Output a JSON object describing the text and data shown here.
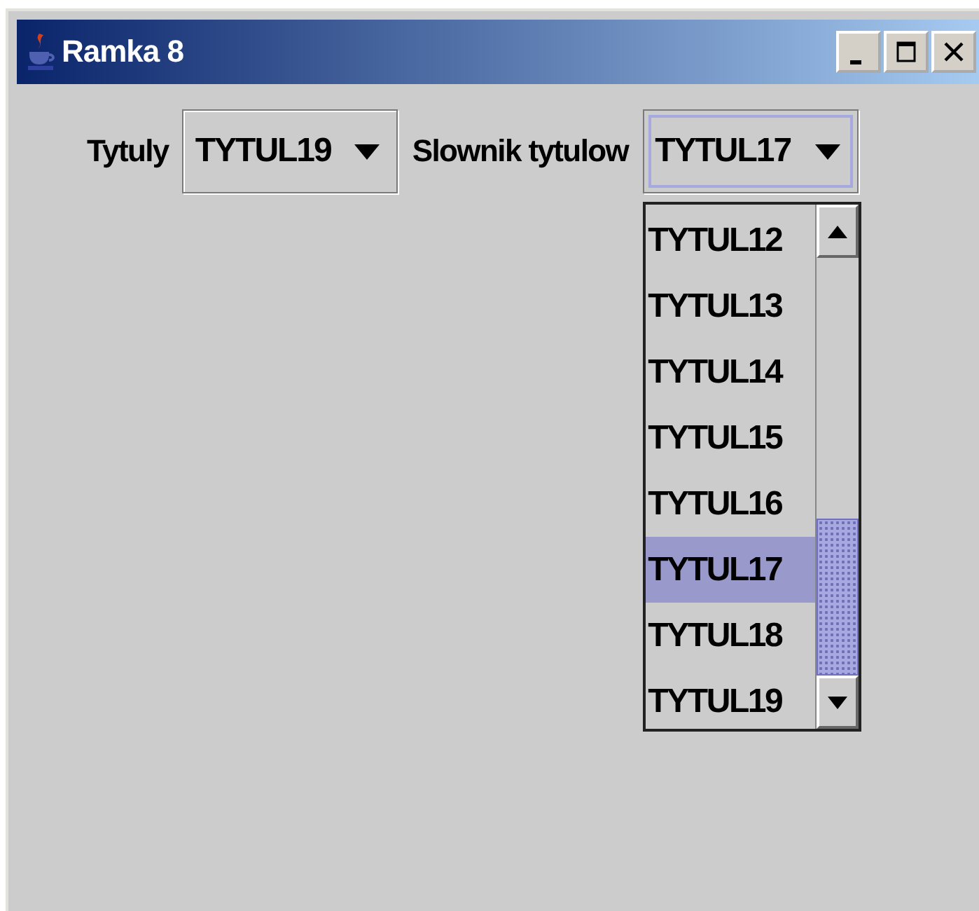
{
  "window": {
    "title": "Ramka 8"
  },
  "row": [
    {
      "kind": "label",
      "text": "Tytuly"
    },
    {
      "kind": "combo",
      "value": "TYTUL19",
      "focused": false
    },
    {
      "kind": "label",
      "text": "Slownik tytulow"
    },
    {
      "kind": "combo",
      "value": "TYTUL17",
      "focused": true,
      "expanded": true,
      "options": [
        {
          "label": "TYTUL12",
          "selected": false
        },
        {
          "label": "TYTUL13",
          "selected": false
        },
        {
          "label": "TYTUL14",
          "selected": false
        },
        {
          "label": "TYTUL15",
          "selected": false
        },
        {
          "label": "TYTUL16",
          "selected": false
        },
        {
          "label": "TYTUL17",
          "selected": true
        },
        {
          "label": "TYTUL18",
          "selected": false
        },
        {
          "label": "TYTUL19",
          "selected": false
        }
      ]
    }
  ]
}
